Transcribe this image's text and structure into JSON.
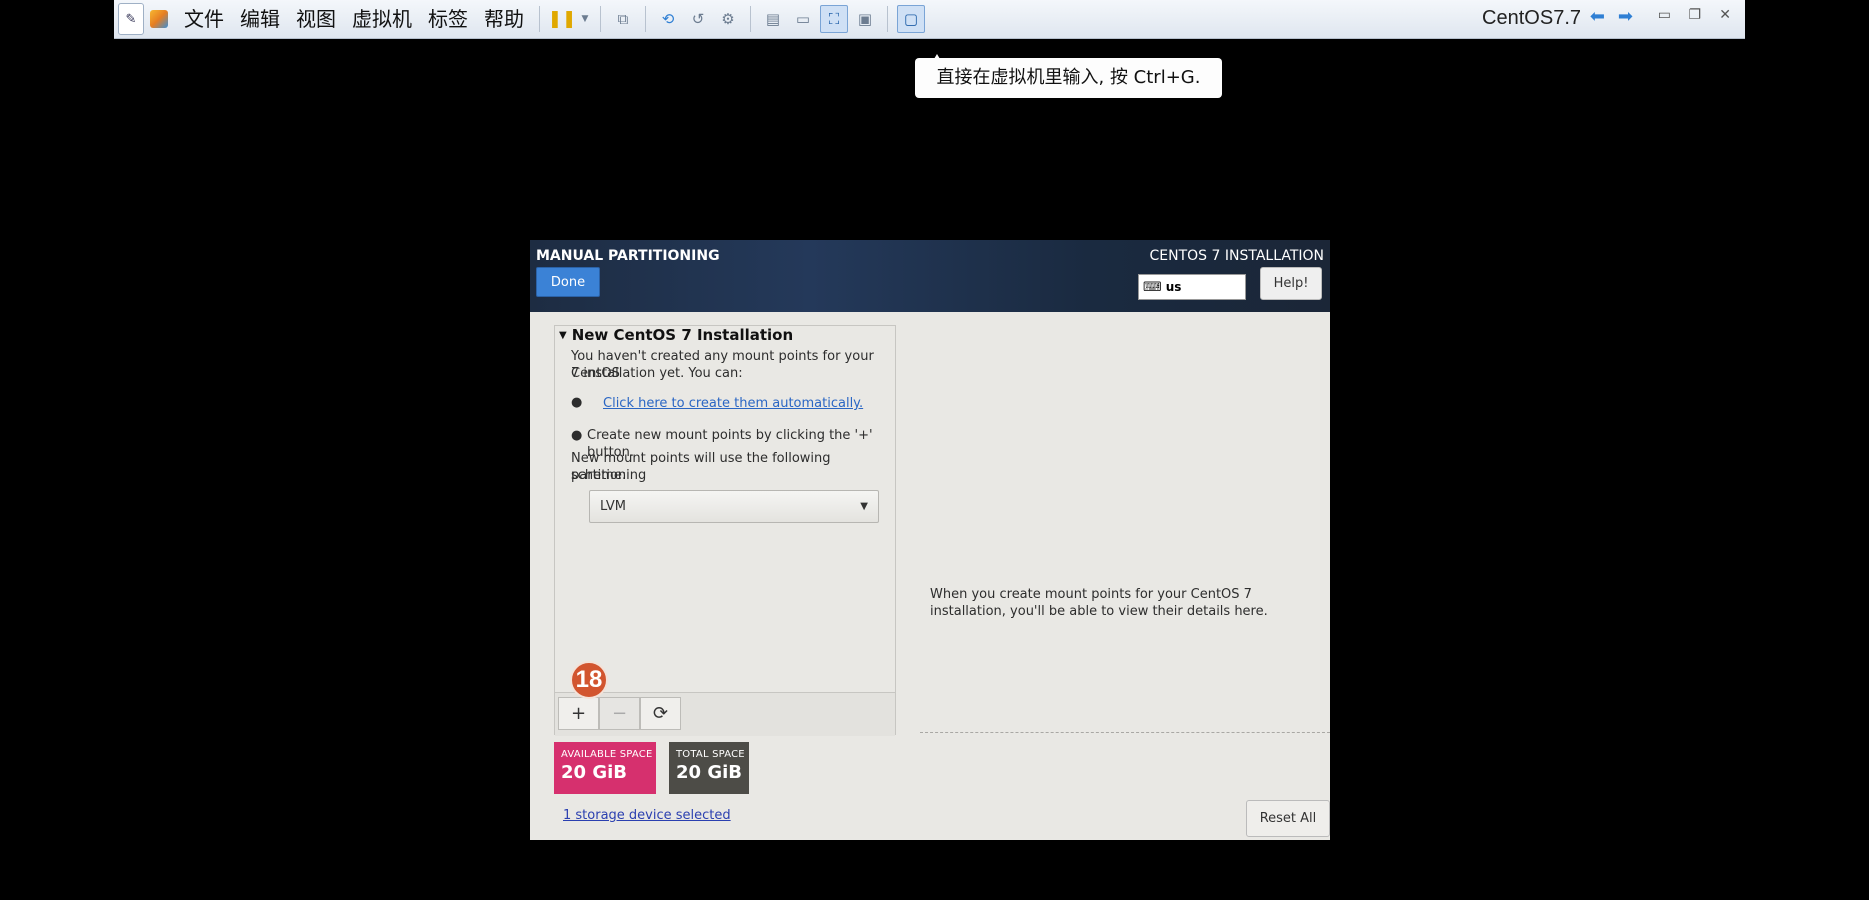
{
  "vm_toolbar": {
    "menu": [
      "文件",
      "编辑",
      "视图",
      "虚拟机",
      "标签",
      "帮助"
    ],
    "vm_title": "CentOS7.7"
  },
  "tooltip": {
    "text": "直接在虚拟机里输入, 按 Ctrl+G."
  },
  "installer": {
    "header": {
      "title": "MANUAL PARTITIONING",
      "done_label": "Done",
      "product": "CENTOS 7 INSTALLATION",
      "keyboard_layout": "us",
      "help_label": "Help!"
    },
    "left_panel": {
      "heading": "New CentOS 7 Installation",
      "intro_line1": "You haven't created any mount points for your CentOS",
      "intro_line2": "7 installation yet.  You can:",
      "auto_link": "Click here to create them automatically.",
      "manual_hint": "Create new mount points by clicking the '+' button.",
      "scheme_line1": "New mount points will use the following partitioning",
      "scheme_line2": "scheme:",
      "scheme_value": "LVM",
      "add_label": "+",
      "remove_label": "−",
      "refresh_label": "⟳",
      "step_badge": "18"
    },
    "space": {
      "available_label": "AVAILABLE SPACE",
      "available_value": "20 GiB",
      "total_label": "TOTAL SPACE",
      "total_value": "20 GiB"
    },
    "storage_link": "1 storage device selected",
    "reset_label": "Reset All",
    "details_text": "When you create mount points for your CentOS 7 installation, you'll be able to view their details here.",
    "colors": {
      "available_bg": "#d6306e",
      "total_bg": "#4d4c47",
      "done_bg": "#3b82d6"
    }
  }
}
